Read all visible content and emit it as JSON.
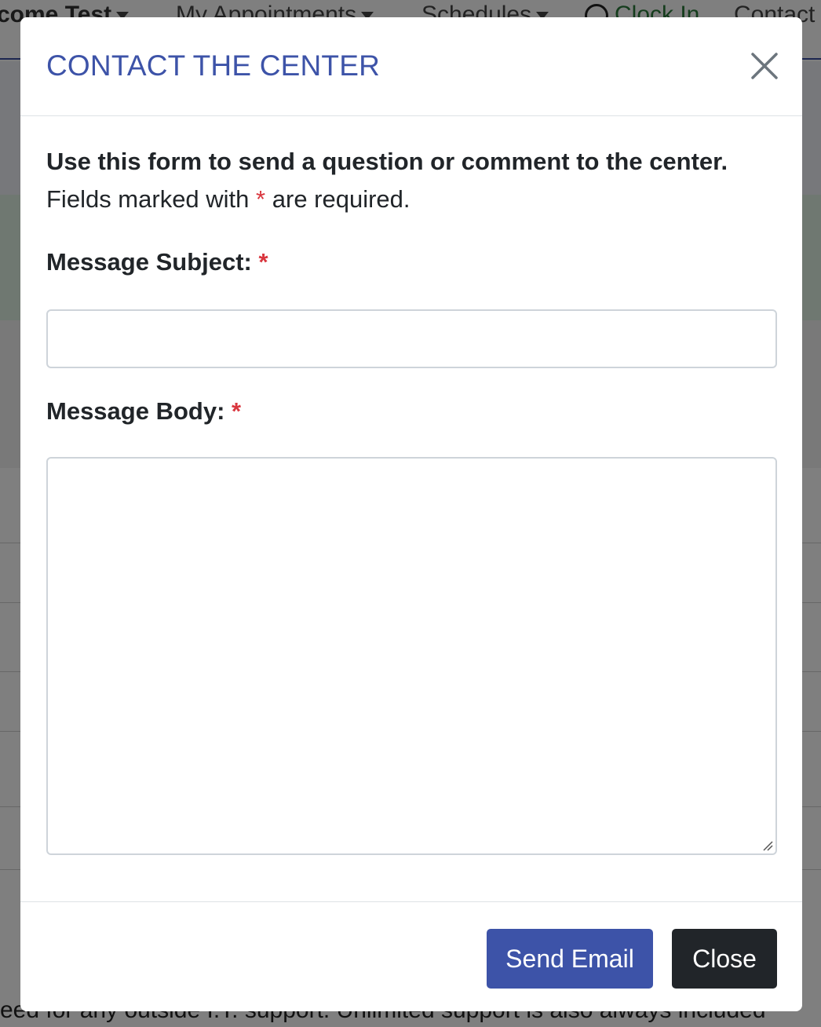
{
  "background": {
    "nav": {
      "welcome": "come Test",
      "appointments": "My Appointments",
      "schedules": "Schedules",
      "clock_in": "Clock In",
      "contact": "Contact"
    },
    "bottom_text": "eed for any outside I.T. support. Unlimited support is also always included"
  },
  "modal": {
    "title": "CONTACT THE CENTER",
    "intro": "Use this form to send a question or comment to the center.",
    "required_note_before": "Fields marked with",
    "required_marker": "*",
    "required_note_after": "are required.",
    "subject_label": "Message Subject:",
    "subject_value": "",
    "body_label": "Message Body:",
    "body_value": "",
    "send_button": "Send Email",
    "close_button": "Close"
  },
  "colors": {
    "accent": "#3d53a8",
    "required": "#d9363e",
    "dark_button": "#212529"
  }
}
